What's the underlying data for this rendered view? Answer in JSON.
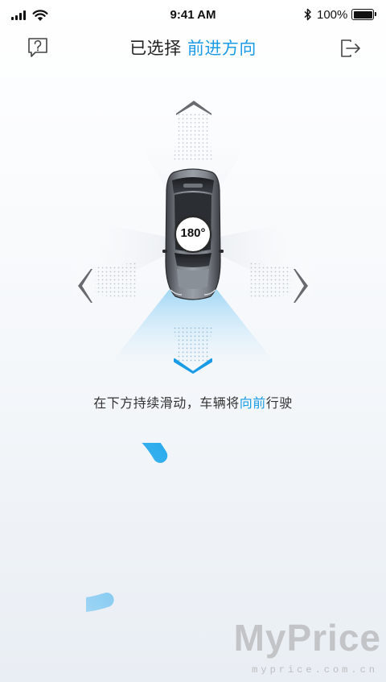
{
  "status_bar": {
    "time": "9:41 AM",
    "battery_percent": "100%",
    "battery_level": 1.0
  },
  "nav": {
    "title_prefix": "已选择",
    "title_direction": "前进方向",
    "help_icon": "question-mark-icon",
    "exit_icon": "exit-icon"
  },
  "control": {
    "rotation_label": "180°",
    "selected_direction": "down",
    "accent_color": "#1a9be6"
  },
  "hint": {
    "prefix": "在下方持续滑动，车辆将",
    "direction": "向前",
    "suffix": "行驶"
  },
  "slider": {
    "progress": 0.72
  },
  "watermark": {
    "main": "MyPrice",
    "sub": "myprice.com.cn"
  }
}
